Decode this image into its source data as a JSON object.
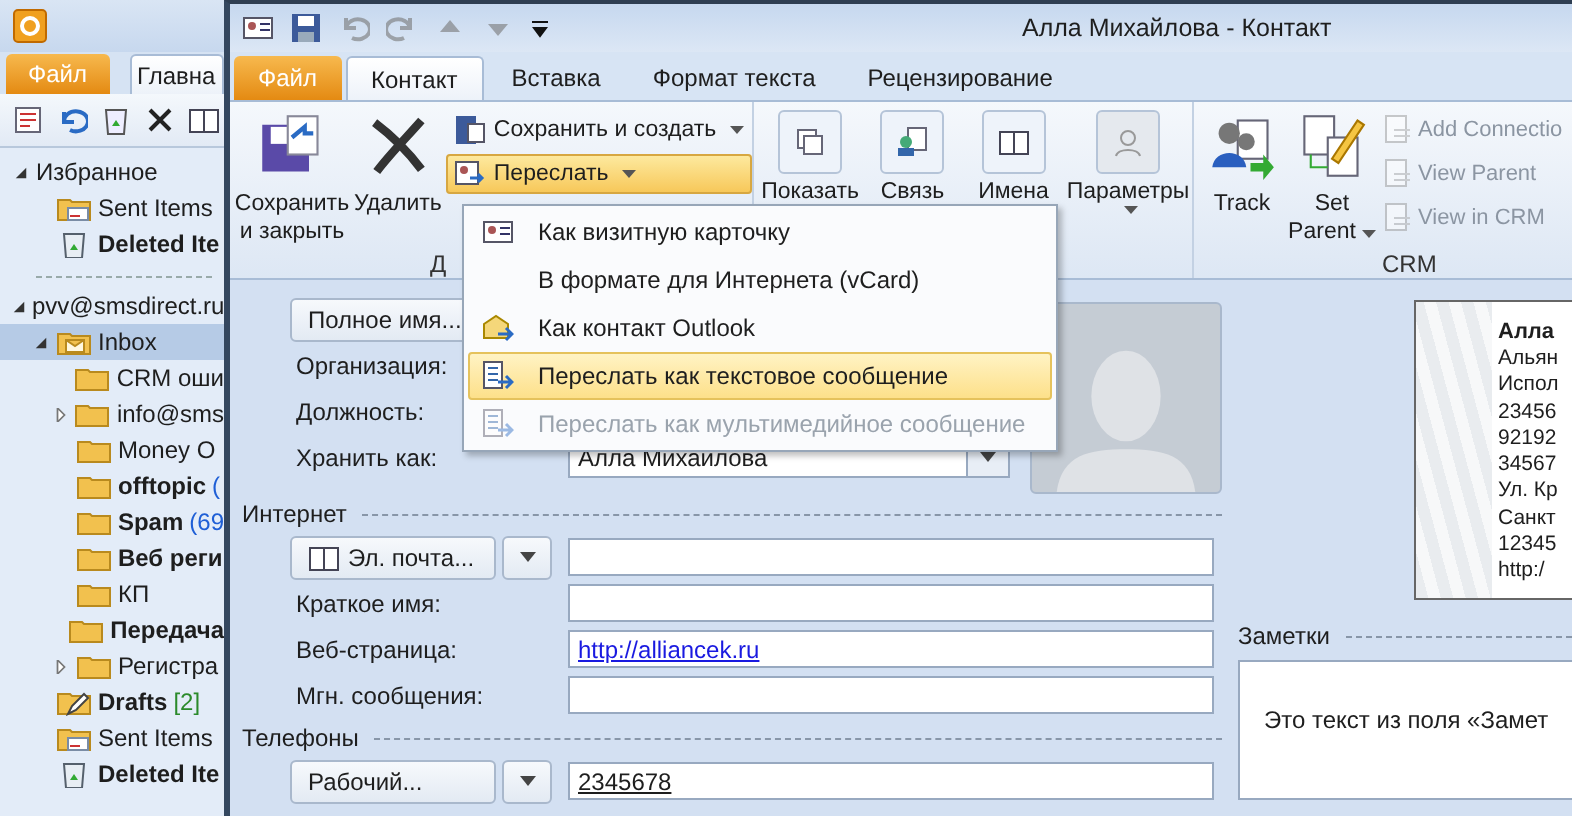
{
  "main_window": {
    "tabs": [
      {
        "label": "Файл",
        "kind": "file",
        "selected": false
      },
      {
        "label": "Главна",
        "kind": "normal",
        "selected": true
      }
    ],
    "navigation": [
      {
        "label": "Избранное",
        "bold": false,
        "selected": false,
        "expanded": true,
        "children": [
          {
            "label": "Sent Items",
            "kind": "sent",
            "bold": false,
            "selected": false
          },
          {
            "label": "Deleted Ite",
            "kind": "deleted",
            "bold": true,
            "selected": false
          }
        ]
      },
      {
        "label": "pvv@smsdirect.ru",
        "bold": false,
        "selected": false,
        "expanded": true,
        "children": [
          {
            "label": "Inbox",
            "kind": "inbox",
            "bold": false,
            "selected": true,
            "expanded": true,
            "children": [
              {
                "label": "CRM оши",
                "kind": "folder",
                "bold": false,
                "selected": false
              },
              {
                "label": "info@sms",
                "kind": "folder",
                "bold": false,
                "selected": false,
                "expanded": false
              },
              {
                "label": "Money O",
                "kind": "folder",
                "bold": false,
                "selected": false
              },
              {
                "label": "offtopic",
                "kind": "folder",
                "bold": true,
                "selected": false,
                "count": "(",
                "color": "#1f5fd6"
              },
              {
                "label": "Spam",
                "kind": "folder",
                "bold": true,
                "selected": false,
                "count": "(69",
                "color": "#1f5fd6"
              },
              {
                "label": "Веб реги",
                "kind": "folder",
                "bold": true,
                "selected": false
              },
              {
                "label": "КП",
                "kind": "folder",
                "bold": false,
                "selected": false
              },
              {
                "label": "Передача",
                "kind": "folder",
                "bold": true,
                "selected": false
              },
              {
                "label": "Регистра",
                "kind": "folder",
                "bold": false,
                "selected": false,
                "expanded": false
              }
            ]
          },
          {
            "label": "Drafts",
            "kind": "drafts",
            "bold": true,
            "selected": false,
            "count": "[2]",
            "color": "#2b8a2b"
          },
          {
            "label": "Sent Items",
            "kind": "sent",
            "bold": false,
            "selected": false
          },
          {
            "label": "Deleted Ite",
            "kind": "deleted",
            "bold": true,
            "selected": false
          }
        ]
      }
    ]
  },
  "contact_window": {
    "title": "Алла Михайлова  -  Контакт",
    "tabs": [
      {
        "label": "Файл",
        "kind": "file",
        "selected": false
      },
      {
        "label": "Контакт",
        "kind": "normal",
        "selected": true
      },
      {
        "label": "Вставка",
        "kind": "normal",
        "selected": false
      },
      {
        "label": "Формат текста",
        "kind": "normal",
        "selected": false
      },
      {
        "label": "Рецензирование",
        "kind": "normal",
        "selected": false
      }
    ],
    "ribbon": {
      "save_and_close": "Сохранить и закрыть",
      "delete": "Удалить",
      "save_and_new": "Сохранить и создать",
      "forward": {
        "label": "Переслать",
        "open": true
      },
      "actions_group_label": "Д",
      "show": "Показать",
      "link": "Связь",
      "names": "Имена",
      "options": "Параметры",
      "track": "Track",
      "set_parent": "Set Parent",
      "crm_links": [
        {
          "label": "Add Connectio",
          "disabled": true
        },
        {
          "label": "View Parent",
          "disabled": true
        },
        {
          "label": "View in CRM",
          "disabled": true
        }
      ],
      "crm_group_label": "CRM"
    },
    "forward_menu": [
      {
        "label": "Как визитную карточку",
        "selected": false,
        "disabled": false
      },
      {
        "label": "В формате для Интернета (vCard)",
        "selected": false,
        "disabled": false
      },
      {
        "label": "Как контакт Outlook",
        "selected": false,
        "disabled": false
      },
      {
        "label": "Переслать как текстовое сообщение",
        "selected": true,
        "disabled": false
      },
      {
        "label": "Переслать как мультимедийное сообщение",
        "selected": false,
        "disabled": true
      }
    ],
    "form": {
      "name_rows": [
        {
          "kind": "button",
          "label": "Полное имя..."
        },
        {
          "kind": "label",
          "label": "Организация:"
        },
        {
          "kind": "label",
          "label": "Должность:"
        },
        {
          "kind": "combo",
          "label": "Хранить как:",
          "value": "Алла Михайлова"
        }
      ],
      "sections": [
        {
          "title": "Интернет",
          "rows": [
            {
              "kind": "dropdown_button",
              "label": "Эл. почта..."
            },
            {
              "kind": "label",
              "label": "Краткое имя:"
            },
            {
              "kind": "label",
              "label": "Веб-страница:",
              "value": "http://alliancek.ru",
              "link": true
            },
            {
              "kind": "label",
              "label": "Мгн. сообщения:"
            }
          ]
        },
        {
          "title": "Телефоны",
          "rows": [
            {
              "kind": "dropdown_button",
              "label": "Рабочий...",
              "value": "2345678",
              "link": false
            }
          ]
        }
      ]
    },
    "business_card": {
      "name": "Алла",
      "lines": [
        "Альян",
        "Испол",
        "23456",
        "92192",
        "34567",
        "Ул. Кр",
        "Санкт",
        "12345",
        "http:/"
      ]
    },
    "notes": {
      "title": "Заметки",
      "text": "Это текст из поля «Замет"
    }
  }
}
